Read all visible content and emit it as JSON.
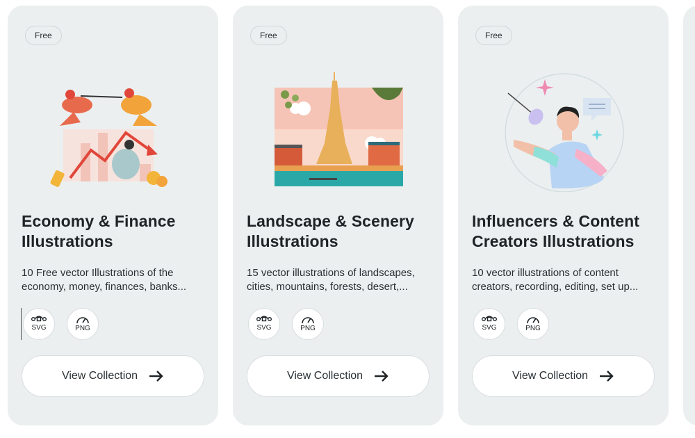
{
  "cards": [
    {
      "badge": "Free",
      "title_line1": "Economy & Finance",
      "title_line2": "Illustrations",
      "desc_line1": "10 Free vector Illustrations of the",
      "desc_line2": "economy, money, finances, banks...",
      "formats": [
        "SVG",
        "PNG"
      ],
      "button": "View Collection",
      "illustration": "economy-finance-illustration"
    },
    {
      "badge": "Free",
      "title_line1": "Landscape & Scenery",
      "title_line2": "Illustrations",
      "desc_line1": "15 vector illustrations of landscapes,",
      "desc_line2": "cities, mountains, forests, desert,...",
      "formats": [
        "SVG",
        "PNG"
      ],
      "button": "View Collection",
      "illustration": "paris-landscape-illustration"
    },
    {
      "badge": "Free",
      "title_line1": "Influencers & Content",
      "title_line2": "Creators Illustrations",
      "desc_line1": "10 vector illustrations of content",
      "desc_line2": "creators, recording, editing, set up...",
      "formats": [
        "SVG",
        "PNG"
      ],
      "button": "View Collection",
      "illustration": "content-creator-illustration"
    }
  ],
  "icons": {
    "svg_format": "vector-path-icon",
    "png_format": "gauge-icon",
    "button_arrow": "arrow-right-icon"
  },
  "colors": {
    "card_bg": "#ebeff0",
    "text": "#1f2326",
    "accent_orange": "#f2a33a",
    "accent_red": "#e0473a"
  }
}
